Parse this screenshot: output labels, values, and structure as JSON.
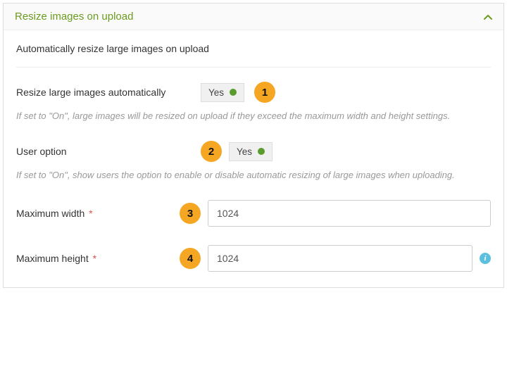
{
  "panel": {
    "title": "Resize images on upload",
    "intro": "Automatically resize large images on upload"
  },
  "settings": {
    "auto_resize": {
      "label": "Resize large images automatically",
      "value": "Yes",
      "help": "If set to \"On\", large images will be resized on upload if they exceed the maximum width and height settings."
    },
    "user_option": {
      "label": "User option",
      "value": "Yes",
      "help": "If set to \"On\", show users the option to enable or disable automatic resizing of large images when uploading."
    },
    "max_width": {
      "label": "Maximum width",
      "required_mark": "*",
      "value": "1024"
    },
    "max_height": {
      "label": "Maximum height",
      "required_mark": "*",
      "value": "1024"
    }
  },
  "markers": {
    "m1": "1",
    "m2": "2",
    "m3": "3",
    "m4": "4"
  },
  "icons": {
    "info": "i"
  }
}
